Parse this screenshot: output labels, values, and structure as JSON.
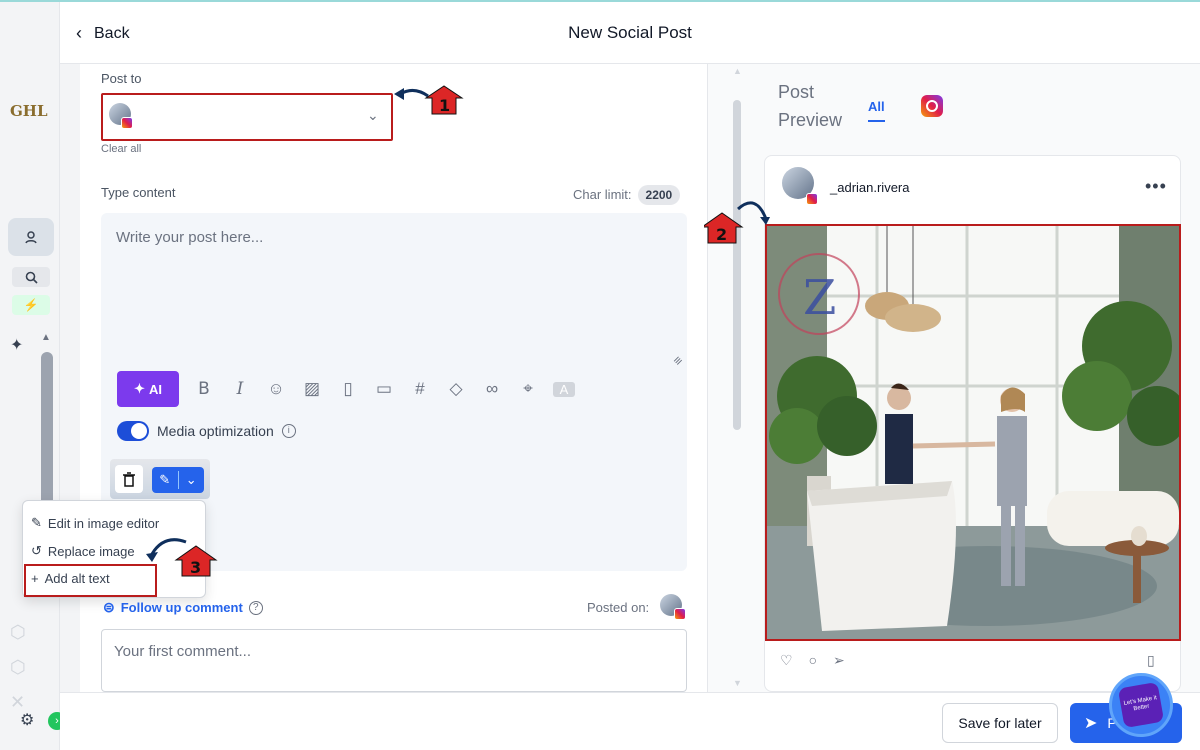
{
  "header": {
    "back_label": "Back",
    "title": "New Social Post"
  },
  "rail": {
    "brand": "GHL"
  },
  "editor": {
    "post_to_label": "Post to",
    "clear_all": "Clear all",
    "type_content_label": "Type content",
    "char_limit_label": "Char limit:",
    "char_limit_value": "2200",
    "content_placeholder": "Write your post here...",
    "ai_label": "AI",
    "toolbar_icons": [
      "bold-icon",
      "italic-icon",
      "emoji-icon",
      "image-icon",
      "file-icon",
      "video-icon",
      "hashtag-icon",
      "tag-icon",
      "link-icon",
      "location-icon",
      "text-icon"
    ],
    "media_optimization_label": "Media optimization",
    "media_optimization_on": true,
    "follow_up_label": "Follow up comment",
    "posted_on_label": "Posted on:",
    "comment_placeholder": "Your first comment..."
  },
  "image_menu": {
    "items": [
      {
        "label": "Edit in image editor",
        "icon": "pencil-icon"
      },
      {
        "label": "Replace image",
        "icon": "rotate-icon"
      },
      {
        "label": "Add alt text",
        "icon": "plus-icon"
      }
    ]
  },
  "preview": {
    "title": "Post Preview",
    "tab_all": "All",
    "username": "_adrian.rivera",
    "image_watermark": "Z"
  },
  "footer": {
    "save_later": "Save for later",
    "post_label": "P"
  },
  "badge": {
    "text": "Let's Make it Better"
  },
  "annotations": [
    {
      "number": "1"
    },
    {
      "number": "2"
    },
    {
      "number": "3"
    }
  ],
  "colors": {
    "accent": "#2563eb",
    "ai": "#7c3aed",
    "highlight": "#b91c1c"
  }
}
